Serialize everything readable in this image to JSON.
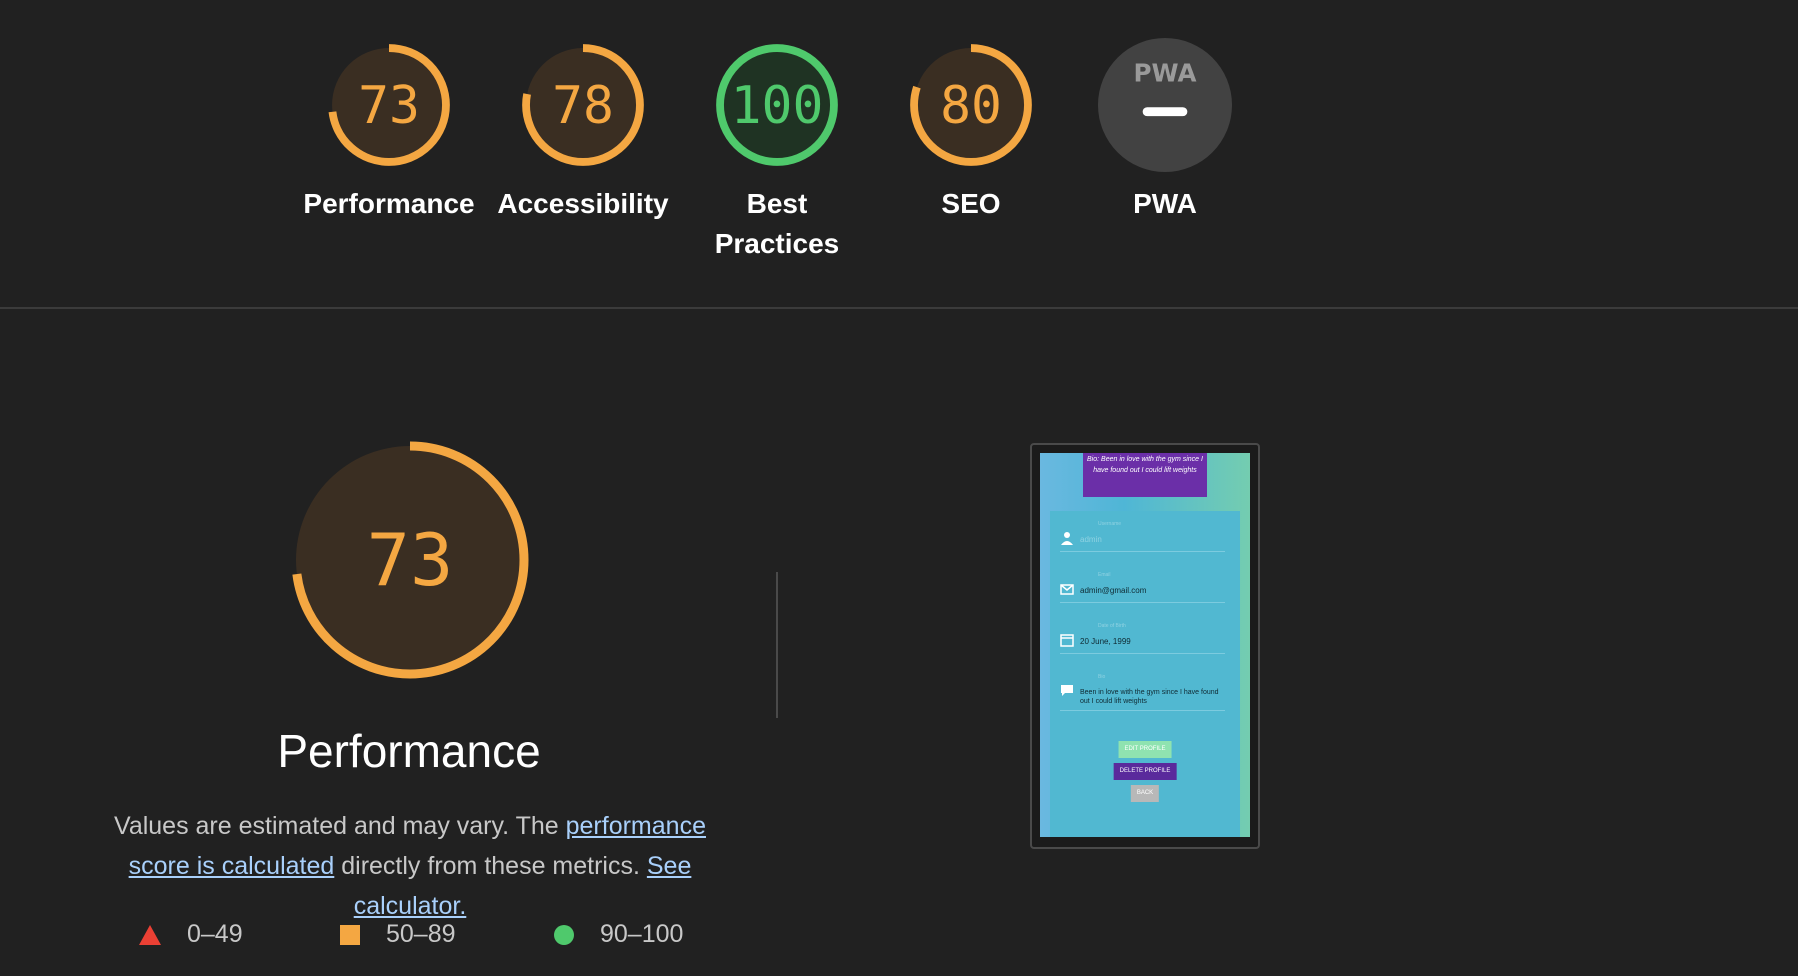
{
  "colors": {
    "background": "#212121",
    "average": "#f4a742",
    "average_fill": "#3a2e22",
    "pass": "#4fc96c",
    "pass_fill": "#1f3323",
    "fail": "#eb4034",
    "pwa_fill": "#424242",
    "link": "#a9d0fb"
  },
  "categories": [
    {
      "score": "73",
      "value": 73,
      "label": "Performance",
      "status": "average"
    },
    {
      "score": "78",
      "value": 78,
      "label": "Accessibility",
      "status": "average"
    },
    {
      "score": "100",
      "value": 100,
      "label": "Best Practices",
      "status": "pass"
    },
    {
      "score": "80",
      "value": 80,
      "label": "SEO",
      "status": "average"
    },
    {
      "score": "",
      "value": null,
      "label": "PWA",
      "status": "na",
      "badge_text": "PWA"
    }
  ],
  "performance": {
    "score": "73",
    "value": 73,
    "title": "Performance",
    "description_prefix": "Values are estimated and may vary. The ",
    "link_score": "performance score is calculated",
    "description_middle": " directly from these metrics. ",
    "link_calculator": "See calculator."
  },
  "legend": [
    {
      "icon": "triangle-icon",
      "range": "0–49"
    },
    {
      "icon": "square-icon",
      "range": "50–89"
    },
    {
      "icon": "circle-icon",
      "range": "90–100"
    }
  ],
  "screenshot": {
    "bio": "Bio: Been in love with the gym since I have found out I could lift weights",
    "username_label": "Username",
    "username": "admin",
    "email_label": "Email",
    "email": "admin@gmail.com",
    "dob_label": "Date of Birth",
    "dob": "20 June, 1999",
    "bio_label": "Bio",
    "bio_value": "Been in love with the gym since I have found out I could lift weights",
    "edit_button": "EDIT PROFILE",
    "delete_button": "DELETE PROFILE",
    "back_button": "BACK"
  }
}
